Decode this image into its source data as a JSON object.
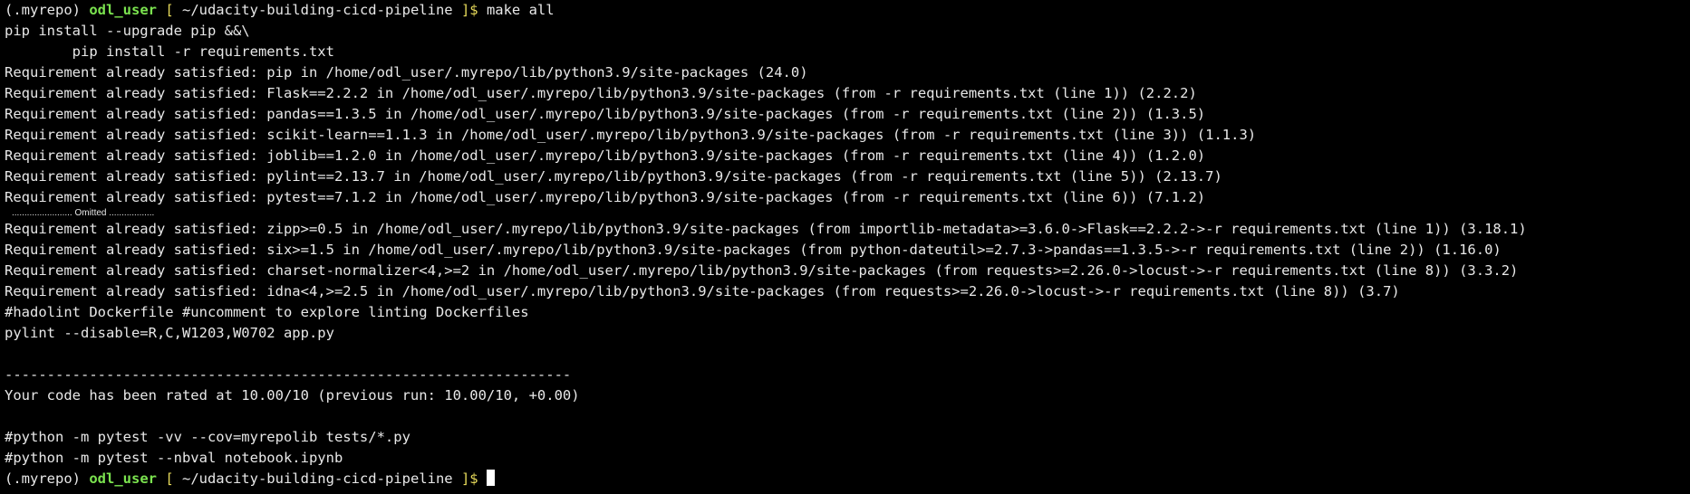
{
  "prompt": {
    "env": "(.myrepo) ",
    "user": "odl_user",
    "open": " [ ",
    "path": "~/udacity-building-cicd-pipeline",
    "close": " ]$ "
  },
  "command": "make all",
  "lines_block1": [
    "pip install --upgrade pip &&\\",
    "        pip install -r requirements.txt",
    "Requirement already satisfied: pip in /home/odl_user/.myrepo/lib/python3.9/site-packages (24.0)",
    "Requirement already satisfied: Flask==2.2.2 in /home/odl_user/.myrepo/lib/python3.9/site-packages (from -r requirements.txt (line 1)) (2.2.2)",
    "Requirement already satisfied: pandas==1.3.5 in /home/odl_user/.myrepo/lib/python3.9/site-packages (from -r requirements.txt (line 2)) (1.3.5)",
    "Requirement already satisfied: scikit-learn==1.1.3 in /home/odl_user/.myrepo/lib/python3.9/site-packages (from -r requirements.txt (line 3)) (1.1.3)",
    "Requirement already satisfied: joblib==1.2.0 in /home/odl_user/.myrepo/lib/python3.9/site-packages (from -r requirements.txt (line 4)) (1.2.0)",
    "Requirement already satisfied: pylint==2.13.7 in /home/odl_user/.myrepo/lib/python3.9/site-packages (from -r requirements.txt (line 5)) (2.13.7)",
    "Requirement already satisfied: pytest==7.1.2 in /home/odl_user/.myrepo/lib/python3.9/site-packages (from -r requirements.txt (line 6)) (7.1.2)"
  ],
  "omitted": "........................ Omitted ..................",
  "lines_block2": [
    "Requirement already satisfied: zipp>=0.5 in /home/odl_user/.myrepo/lib/python3.9/site-packages (from importlib-metadata>=3.6.0->Flask==2.2.2->-r requirements.txt (line 1)) (3.18.1)",
    "Requirement already satisfied: six>=1.5 in /home/odl_user/.myrepo/lib/python3.9/site-packages (from python-dateutil>=2.7.3->pandas==1.3.5->-r requirements.txt (line 2)) (1.16.0)",
    "Requirement already satisfied: charset-normalizer<4,>=2 in /home/odl_user/.myrepo/lib/python3.9/site-packages (from requests>=2.26.0->locust->-r requirements.txt (line 8)) (3.3.2)",
    "Requirement already satisfied: idna<4,>=2.5 in /home/odl_user/.myrepo/lib/python3.9/site-packages (from requests>=2.26.0->locust->-r requirements.txt (line 8)) (3.7)",
    "#hadolint Dockerfile #uncomment to explore linting Dockerfiles",
    "pylint --disable=R,C,W1203,W0702 app.py"
  ],
  "separator": "-------------------------------------------------------------------",
  "rating": "Your code has been rated at 10.00/10 (previous run: 10.00/10, +0.00)",
  "lines_block3": [
    "#python -m pytest -vv --cov=myrepolib tests/*.py",
    "#python -m pytest --nbval notebook.ipynb"
  ],
  "colors": {
    "background": "#000000",
    "text": "#e8e8e8",
    "user": "#7be34f"
  }
}
